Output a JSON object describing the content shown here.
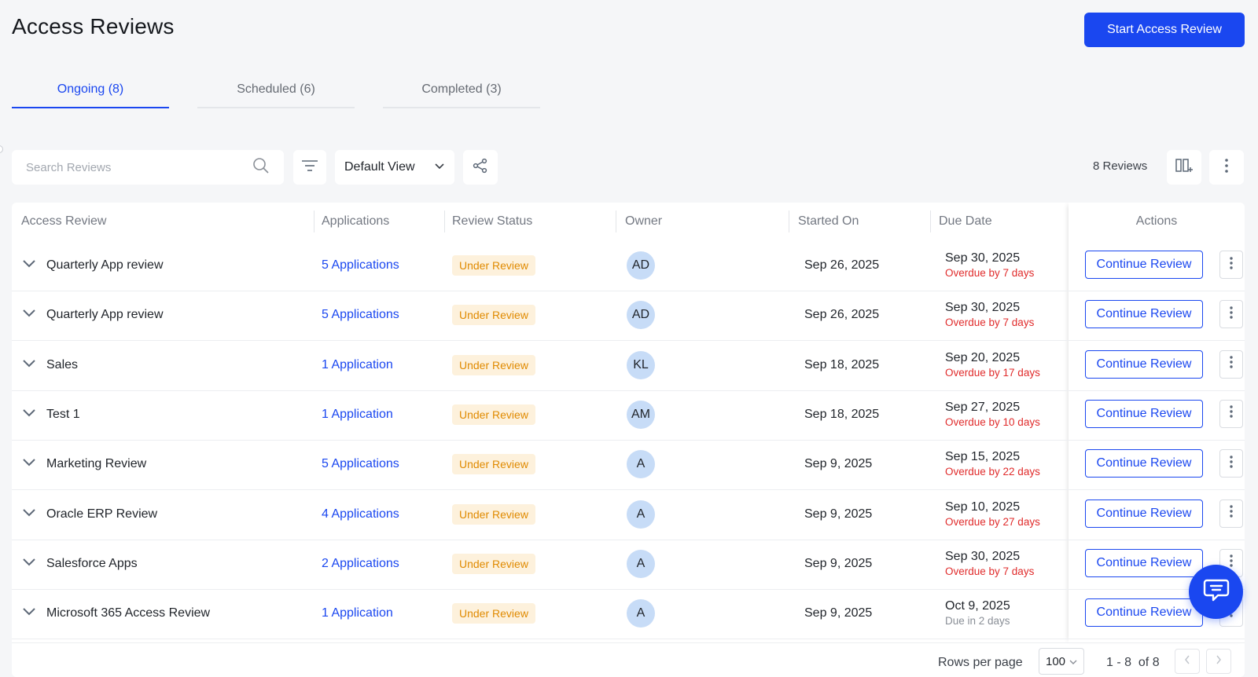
{
  "header": {
    "title": "Access Reviews",
    "primary_action": "Start Access Review"
  },
  "tabs": [
    {
      "label": "Ongoing (8)",
      "active": true
    },
    {
      "label": "Scheduled (6)",
      "active": false
    },
    {
      "label": "Completed (3)",
      "active": false
    }
  ],
  "toolbar": {
    "search_placeholder": "Search Reviews",
    "view_label": "Default View",
    "count_label": "8 Reviews"
  },
  "table": {
    "columns": [
      "Access Review",
      "Applications",
      "Review Status",
      "Owner",
      "Started On",
      "Due Date",
      "Actions"
    ],
    "action_label": "Continue Review",
    "rows": [
      {
        "name": "Quarterly App review",
        "applications": "5 Applications",
        "status": "Under Review",
        "owner": "AD",
        "started": "Sep 26, 2025",
        "due": "Sep 30, 2025",
        "due_note": "Overdue by 7 days",
        "overdue": true
      },
      {
        "name": "Quarterly App review",
        "applications": "5 Applications",
        "status": "Under Review",
        "owner": "AD",
        "started": "Sep 26, 2025",
        "due": "Sep 30, 2025",
        "due_note": "Overdue by 7 days",
        "overdue": true
      },
      {
        "name": "Sales",
        "applications": "1 Application",
        "status": "Under Review",
        "owner": "KL",
        "started": "Sep 18, 2025",
        "due": "Sep 20, 2025",
        "due_note": "Overdue by 17 days",
        "overdue": true
      },
      {
        "name": "Test 1",
        "applications": "1 Application",
        "status": "Under Review",
        "owner": "AM",
        "started": "Sep 18, 2025",
        "due": "Sep 27, 2025",
        "due_note": "Overdue by 10 days",
        "overdue": true
      },
      {
        "name": "Marketing Review",
        "applications": "5 Applications",
        "status": "Under Review",
        "owner": "A",
        "started": "Sep 9, 2025",
        "due": "Sep 15, 2025",
        "due_note": "Overdue by 22 days",
        "overdue": true
      },
      {
        "name": "Oracle ERP Review",
        "applications": "4 Applications",
        "status": "Under Review",
        "owner": "A",
        "started": "Sep 9, 2025",
        "due": "Sep 10, 2025",
        "due_note": "Overdue by 27 days",
        "overdue": true
      },
      {
        "name": "Salesforce Apps",
        "applications": "2 Applications",
        "status": "Under Review",
        "owner": "A",
        "started": "Sep 9, 2025",
        "due": "Sep 30, 2025",
        "due_note": "Overdue by 7 days",
        "overdue": true
      },
      {
        "name": "Microsoft 365 Access Review",
        "applications": "1 Application",
        "status": "Under Review",
        "owner": "A",
        "started": "Sep 9, 2025",
        "due": "Oct 9, 2025",
        "due_note": "Due in 2 days",
        "overdue": false
      }
    ]
  },
  "pagination": {
    "rows_per_page_label": "Rows per page",
    "rows_per_page": "100",
    "range": "1 - 8",
    "of": "of 8"
  },
  "icons": {
    "search": "search-icon",
    "filter": "filter-icon",
    "chevron": "chevron-down-icon",
    "share": "share-icon",
    "columns": "columns-icon",
    "more": "more-vertical-icon",
    "chat": "chat-icon",
    "prev": "chevron-left-icon",
    "next": "chevron-right-icon"
  },
  "colors": {
    "accent": "#1a47f0",
    "overdue": "#e02b2b",
    "status_bg": "#fdf1dc",
    "status_text": "#e08a00",
    "avatar_bg": "#c7dcf7"
  }
}
